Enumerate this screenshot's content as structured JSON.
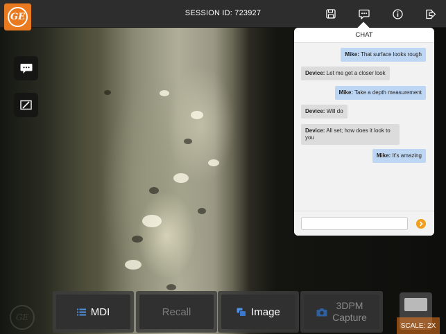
{
  "app": {
    "session_label": "SESSION ID: 723927",
    "brand_logo_text": "GE",
    "accent_color": "#e97a1f"
  },
  "toolbar": {
    "icons": [
      "save-icon",
      "chat-icon",
      "info-icon",
      "exit-icon"
    ]
  },
  "left_tools": {
    "icons": [
      "chat-bubble-icon",
      "slash-square-icon"
    ]
  },
  "chat": {
    "title": "CHAT",
    "messages": [
      {
        "sender": "Mike:",
        "text": " That surface looks rough",
        "side": "user"
      },
      {
        "sender": "Device:",
        "text": " Let me get a closer look",
        "side": "device"
      },
      {
        "sender": "Mike:",
        "text": " Take a depth measurement",
        "side": "user"
      },
      {
        "sender": "Device:",
        "text": " Will do",
        "side": "device"
      },
      {
        "sender": "Device:",
        "text": " All set; how does it look to you",
        "side": "device"
      },
      {
        "sender": "Mike:",
        "text": " It's amazing",
        "side": "user"
      }
    ],
    "input_value": "",
    "input_placeholder": "",
    "send_icon": "arrow-right-icon"
  },
  "actions": {
    "mdi_label": "MDI",
    "recall_label": "Recall",
    "image_label": "Image",
    "capture_line1": "3DPM",
    "capture_line2": "Capture"
  },
  "scale": {
    "label": "SCALE: 2X"
  }
}
